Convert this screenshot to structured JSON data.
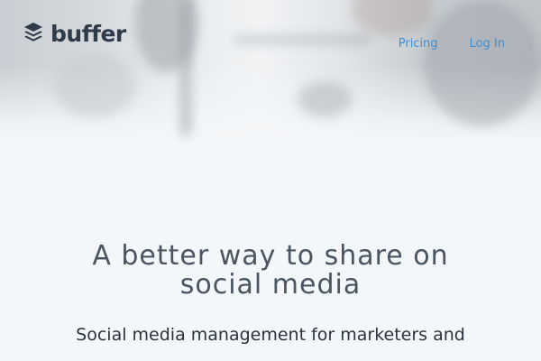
{
  "brand": {
    "name": "buffer",
    "logo_icon": "stacked-layers-icon",
    "text_color": "#2f3b48"
  },
  "nav": {
    "links": [
      {
        "label": "Pricing"
      },
      {
        "label": "Log In"
      }
    ],
    "link_color": "#3f8fd2"
  },
  "hero": {
    "headline_line1": "A better way to share on",
    "headline_line2": "social media",
    "subheadline": "Social media management for marketers and"
  }
}
